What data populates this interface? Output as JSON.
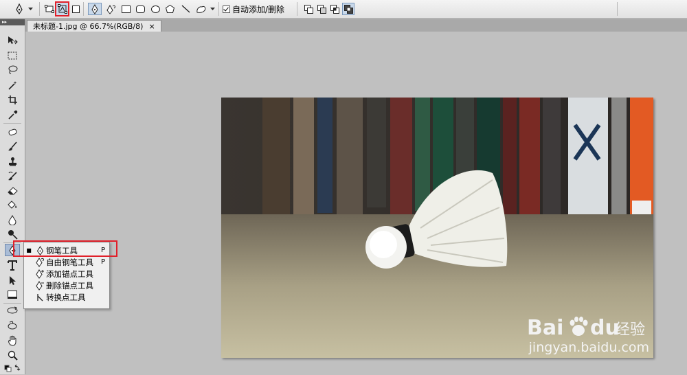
{
  "options_bar": {
    "auto_add_delete_label": "自动添加/删除",
    "auto_add_delete_checked": true
  },
  "document_tab": {
    "title": "未标题-1.jpg @ 66.7%(RGB/8)",
    "close_glyph": "×"
  },
  "tool_flyout": {
    "items": [
      {
        "label": "钢笔工具",
        "shortcut": "P",
        "selected": true,
        "icon": "pen-icon"
      },
      {
        "label": "自由钢笔工具",
        "shortcut": "P",
        "selected": false,
        "icon": "freeform-pen-icon"
      },
      {
        "label": "添加锚点工具",
        "shortcut": "",
        "selected": false,
        "icon": "add-anchor-point-icon"
      },
      {
        "label": "删除锚点工具",
        "shortcut": "",
        "selected": false,
        "icon": "delete-anchor-point-icon"
      },
      {
        "label": "转换点工具",
        "shortcut": "",
        "selected": false,
        "icon": "convert-point-icon"
      }
    ]
  },
  "watermark": {
    "brand": "Bai",
    "brand_suffix": "du",
    "cn_text": "经验",
    "url": "jingyan.baidu.com"
  },
  "colors": {
    "highlight_red": "#e0202a",
    "pressed_blue": "#c8d8ea"
  }
}
